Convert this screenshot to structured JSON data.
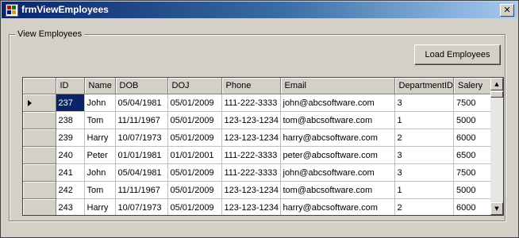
{
  "window": {
    "title": "frmViewEmployees",
    "close_glyph": "✕"
  },
  "group": {
    "label": "View Employees"
  },
  "toolbar": {
    "load_label": "Load Employees"
  },
  "grid": {
    "columns": [
      "ID",
      "Name",
      "DOB",
      "DOJ",
      "Phone",
      "Email",
      "DepartmentID",
      "Salery"
    ],
    "selected_row": 0,
    "rows": [
      [
        "237",
        "John",
        "05/04/1981",
        "05/01/2009",
        "111-222-3333",
        "john@abcsoftware.com",
        "3",
        "7500"
      ],
      [
        "238",
        "Tom",
        "11/11/1967",
        "05/01/2009",
        "123-123-1234",
        "tom@abcsoftware.com",
        "1",
        "5000"
      ],
      [
        "239",
        "Harry",
        "10/07/1973",
        "05/01/2009",
        "123-123-1234",
        "harry@abcsoftware.com",
        "2",
        "6000"
      ],
      [
        "240",
        "Peter",
        "01/01/1981",
        "01/01/2001",
        "111-222-3333",
        "peter@abcsoftware.com",
        "3",
        "6500"
      ],
      [
        "241",
        "John",
        "05/04/1981",
        "05/01/2009",
        "111-222-3333",
        "john@abcsoftware.com",
        "3",
        "7500"
      ],
      [
        "242",
        "Tom",
        "11/11/1967",
        "05/01/2009",
        "123-123-1234",
        "tom@abcsoftware.com",
        "1",
        "5000"
      ],
      [
        "243",
        "Harry",
        "10/07/1973",
        "05/01/2009",
        "123-123-1234",
        "harry@abcsoftware.com",
        "2",
        "6000"
      ]
    ]
  },
  "scrollbar": {
    "up_glyph": "▲",
    "down_glyph": "▼"
  }
}
